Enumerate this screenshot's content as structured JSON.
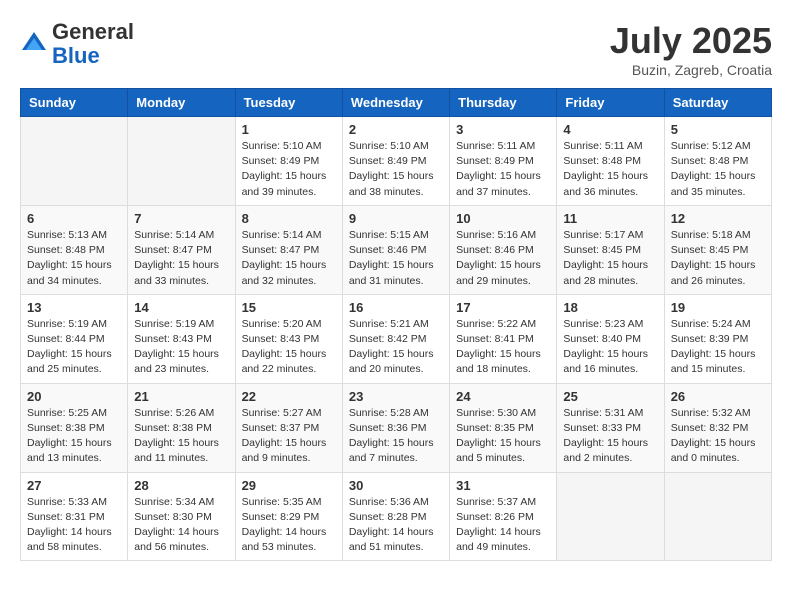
{
  "header": {
    "logo_general": "General",
    "logo_blue": "Blue",
    "month": "July 2025",
    "location": "Buzin, Zagreb, Croatia"
  },
  "days_of_week": [
    "Sunday",
    "Monday",
    "Tuesday",
    "Wednesday",
    "Thursday",
    "Friday",
    "Saturday"
  ],
  "weeks": [
    [
      {
        "day": "",
        "info": ""
      },
      {
        "day": "",
        "info": ""
      },
      {
        "day": "1",
        "info": "Sunrise: 5:10 AM\nSunset: 8:49 PM\nDaylight: 15 hours and 39 minutes."
      },
      {
        "day": "2",
        "info": "Sunrise: 5:10 AM\nSunset: 8:49 PM\nDaylight: 15 hours and 38 minutes."
      },
      {
        "day": "3",
        "info": "Sunrise: 5:11 AM\nSunset: 8:49 PM\nDaylight: 15 hours and 37 minutes."
      },
      {
        "day": "4",
        "info": "Sunrise: 5:11 AM\nSunset: 8:48 PM\nDaylight: 15 hours and 36 minutes."
      },
      {
        "day": "5",
        "info": "Sunrise: 5:12 AM\nSunset: 8:48 PM\nDaylight: 15 hours and 35 minutes."
      }
    ],
    [
      {
        "day": "6",
        "info": "Sunrise: 5:13 AM\nSunset: 8:48 PM\nDaylight: 15 hours and 34 minutes."
      },
      {
        "day": "7",
        "info": "Sunrise: 5:14 AM\nSunset: 8:47 PM\nDaylight: 15 hours and 33 minutes."
      },
      {
        "day": "8",
        "info": "Sunrise: 5:14 AM\nSunset: 8:47 PM\nDaylight: 15 hours and 32 minutes."
      },
      {
        "day": "9",
        "info": "Sunrise: 5:15 AM\nSunset: 8:46 PM\nDaylight: 15 hours and 31 minutes."
      },
      {
        "day": "10",
        "info": "Sunrise: 5:16 AM\nSunset: 8:46 PM\nDaylight: 15 hours and 29 minutes."
      },
      {
        "day": "11",
        "info": "Sunrise: 5:17 AM\nSunset: 8:45 PM\nDaylight: 15 hours and 28 minutes."
      },
      {
        "day": "12",
        "info": "Sunrise: 5:18 AM\nSunset: 8:45 PM\nDaylight: 15 hours and 26 minutes."
      }
    ],
    [
      {
        "day": "13",
        "info": "Sunrise: 5:19 AM\nSunset: 8:44 PM\nDaylight: 15 hours and 25 minutes."
      },
      {
        "day": "14",
        "info": "Sunrise: 5:19 AM\nSunset: 8:43 PM\nDaylight: 15 hours and 23 minutes."
      },
      {
        "day": "15",
        "info": "Sunrise: 5:20 AM\nSunset: 8:43 PM\nDaylight: 15 hours and 22 minutes."
      },
      {
        "day": "16",
        "info": "Sunrise: 5:21 AM\nSunset: 8:42 PM\nDaylight: 15 hours and 20 minutes."
      },
      {
        "day": "17",
        "info": "Sunrise: 5:22 AM\nSunset: 8:41 PM\nDaylight: 15 hours and 18 minutes."
      },
      {
        "day": "18",
        "info": "Sunrise: 5:23 AM\nSunset: 8:40 PM\nDaylight: 15 hours and 16 minutes."
      },
      {
        "day": "19",
        "info": "Sunrise: 5:24 AM\nSunset: 8:39 PM\nDaylight: 15 hours and 15 minutes."
      }
    ],
    [
      {
        "day": "20",
        "info": "Sunrise: 5:25 AM\nSunset: 8:38 PM\nDaylight: 15 hours and 13 minutes."
      },
      {
        "day": "21",
        "info": "Sunrise: 5:26 AM\nSunset: 8:38 PM\nDaylight: 15 hours and 11 minutes."
      },
      {
        "day": "22",
        "info": "Sunrise: 5:27 AM\nSunset: 8:37 PM\nDaylight: 15 hours and 9 minutes."
      },
      {
        "day": "23",
        "info": "Sunrise: 5:28 AM\nSunset: 8:36 PM\nDaylight: 15 hours and 7 minutes."
      },
      {
        "day": "24",
        "info": "Sunrise: 5:30 AM\nSunset: 8:35 PM\nDaylight: 15 hours and 5 minutes."
      },
      {
        "day": "25",
        "info": "Sunrise: 5:31 AM\nSunset: 8:33 PM\nDaylight: 15 hours and 2 minutes."
      },
      {
        "day": "26",
        "info": "Sunrise: 5:32 AM\nSunset: 8:32 PM\nDaylight: 15 hours and 0 minutes."
      }
    ],
    [
      {
        "day": "27",
        "info": "Sunrise: 5:33 AM\nSunset: 8:31 PM\nDaylight: 14 hours and 58 minutes."
      },
      {
        "day": "28",
        "info": "Sunrise: 5:34 AM\nSunset: 8:30 PM\nDaylight: 14 hours and 56 minutes."
      },
      {
        "day": "29",
        "info": "Sunrise: 5:35 AM\nSunset: 8:29 PM\nDaylight: 14 hours and 53 minutes."
      },
      {
        "day": "30",
        "info": "Sunrise: 5:36 AM\nSunset: 8:28 PM\nDaylight: 14 hours and 51 minutes."
      },
      {
        "day": "31",
        "info": "Sunrise: 5:37 AM\nSunset: 8:26 PM\nDaylight: 14 hours and 49 minutes."
      },
      {
        "day": "",
        "info": ""
      },
      {
        "day": "",
        "info": ""
      }
    ]
  ]
}
